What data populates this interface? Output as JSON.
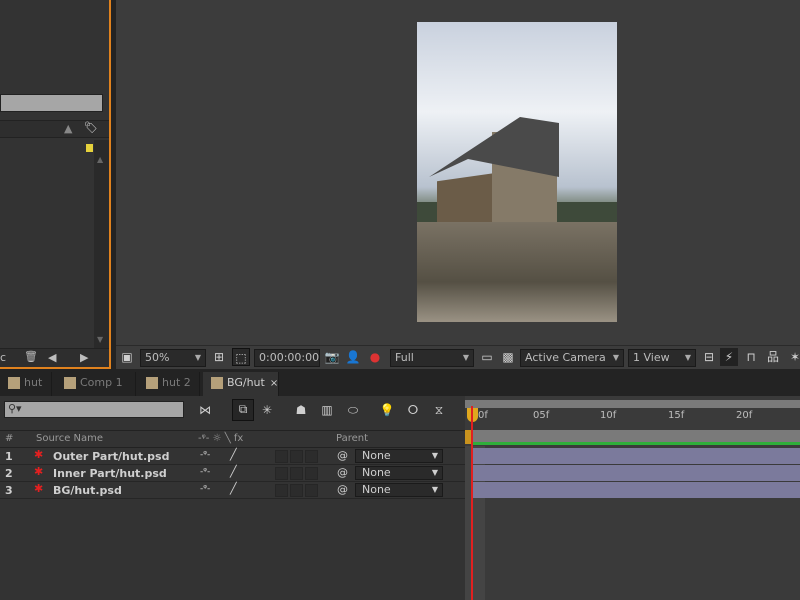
{
  "viewer": {
    "zoom": "50%",
    "timecode": "0:00:00:00",
    "resolution": "Full",
    "camera": "Active Camera",
    "views": "1 View"
  },
  "tabs": [
    {
      "label": "hut"
    },
    {
      "label": "Comp 1"
    },
    {
      "label": "hut 2"
    },
    {
      "label": "BG/hut",
      "active": true
    }
  ],
  "timeline": {
    "search_placeholder": "",
    "columns": {
      "number": "#",
      "source": "Source Name",
      "switches": "-ᵠ- ☼ ╲ fx",
      "parent": "Parent"
    },
    "ruler": [
      "0f",
      "05f",
      "10f",
      "15f",
      "20f"
    ],
    "layers": [
      {
        "index": "1",
        "name": "Outer Part/hut.psd",
        "parent": "None"
      },
      {
        "index": "2",
        "name": "Inner Part/hut.psd",
        "parent": "None"
      },
      {
        "index": "3",
        "name": "BG/hut.psd",
        "parent": "None"
      }
    ],
    "bar_color": "#7b7a9c",
    "work_area_color": "#2fae3a",
    "cti_color": "#e02020"
  },
  "project": {
    "bottom_label": "c"
  }
}
